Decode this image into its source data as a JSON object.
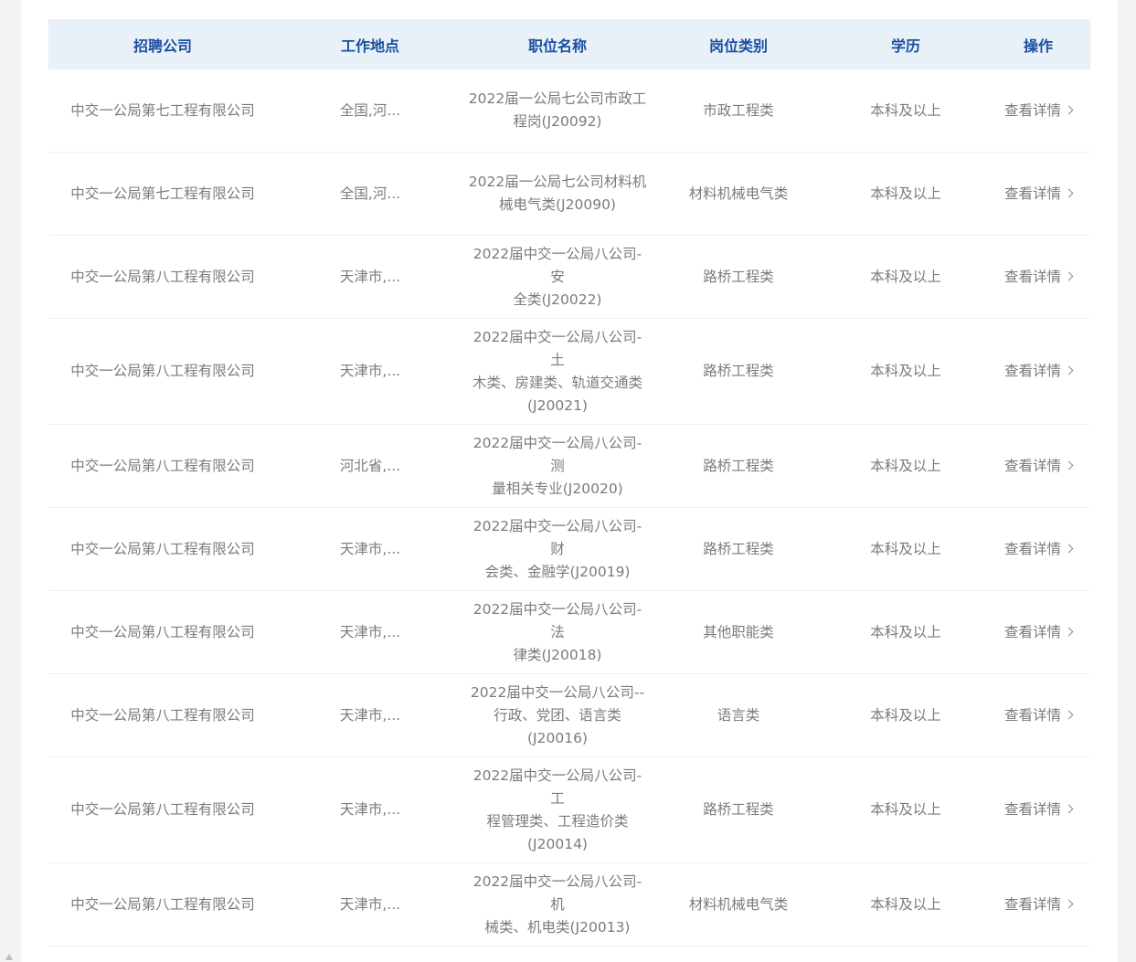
{
  "table": {
    "headers": {
      "company": "招聘公司",
      "location": "工作地点",
      "position": "职位名称",
      "category": "岗位类别",
      "education": "学历",
      "action": "操作"
    },
    "rows": [
      {
        "company": "中交一公局第七工程有限公司",
        "location": "全国,河...",
        "position_lines": [
          "2022届一公局七公司市政工",
          "程岗(J20092)"
        ],
        "category": "市政工程类",
        "education": "本科及以上",
        "action": "查看详情"
      },
      {
        "company": "中交一公局第七工程有限公司",
        "location": "全国,河...",
        "position_lines": [
          "2022届一公局七公司材料机",
          "械电气类(J20090)"
        ],
        "category": "材料机械电气类",
        "education": "本科及以上",
        "action": "查看详情"
      },
      {
        "company": "中交一公局第八工程有限公司",
        "location": "天津市,...",
        "position_lines": [
          "2022届中交一公局八公司-安",
          "全类(J20022)"
        ],
        "category": "路桥工程类",
        "education": "本科及以上",
        "action": "查看详情"
      },
      {
        "company": "中交一公局第八工程有限公司",
        "location": "天津市,...",
        "position_lines": [
          "2022届中交一公局八公司-土",
          "木类、房建类、轨道交通类",
          "(J20021)"
        ],
        "category": "路桥工程类",
        "education": "本科及以上",
        "action": "查看详情"
      },
      {
        "company": "中交一公局第八工程有限公司",
        "location": "河北省,...",
        "position_lines": [
          "2022届中交一公局八公司-测",
          "量相关专业(J20020)"
        ],
        "category": "路桥工程类",
        "education": "本科及以上",
        "action": "查看详情"
      },
      {
        "company": "中交一公局第八工程有限公司",
        "location": "天津市,...",
        "position_lines": [
          "2022届中交一公局八公司-财",
          "会类、金融学(J20019)"
        ],
        "category": "路桥工程类",
        "education": "本科及以上",
        "action": "查看详情"
      },
      {
        "company": "中交一公局第八工程有限公司",
        "location": "天津市,...",
        "position_lines": [
          "2022届中交一公局八公司-法",
          "律类(J20018)"
        ],
        "category": "其他职能类",
        "education": "本科及以上",
        "action": "查看详情"
      },
      {
        "company": "中交一公局第八工程有限公司",
        "location": "天津市,...",
        "position_lines": [
          "2022届中交一公局八公司--",
          "行政、党团、语言类(J20016)"
        ],
        "category": "语言类",
        "education": "本科及以上",
        "action": "查看详情"
      },
      {
        "company": "中交一公局第八工程有限公司",
        "location": "天津市,...",
        "position_lines": [
          "2022届中交一公局八公司-工",
          "程管理类、工程造价类",
          "(J20014)"
        ],
        "category": "路桥工程类",
        "education": "本科及以上",
        "action": "查看详情"
      },
      {
        "company": "中交一公局第八工程有限公司",
        "location": "天津市,...",
        "position_lines": [
          "2022届中交一公局八公司-机",
          "械类、机电类(J20013)"
        ],
        "category": "材料机械电气类",
        "education": "本科及以上",
        "action": "查看详情"
      }
    ]
  },
  "icons": {
    "detail_chevron": "chevron-right-icon",
    "scroll_up": "scroll-up-arrow-icon"
  },
  "colors": {
    "header_background": "#e8f0f8",
    "header_text": "#1a4fa0",
    "body_text": "#7b7b7b",
    "page_background": "#f2f3f5"
  }
}
